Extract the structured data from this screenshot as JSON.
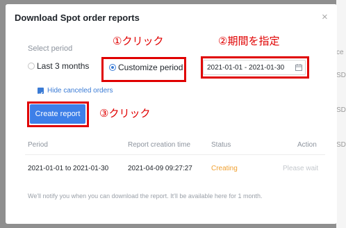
{
  "background": {
    "column_texts": [
      "ce",
      "SD",
      "SD",
      "SD"
    ]
  },
  "dialog": {
    "title": "Download Spot order reports",
    "close_symbol": "×",
    "select_period_label": "Select period",
    "options": {
      "last3": "Last 3 months",
      "customize": "Customize period"
    },
    "selected_option": "Customize period",
    "date_range": "2021-01-01 - 2021-01-30",
    "hide_canceled_label": "Hide canceled orders",
    "hide_canceled_checked": true,
    "create_button": "Create report",
    "table": {
      "headers": {
        "period": "Period",
        "created": "Report creation time",
        "status": "Status",
        "action": "Action"
      },
      "rows": [
        {
          "period": "2021-01-01 to 2021-01-30",
          "created": "2021-04-09 09:27:27",
          "status": "Creating",
          "action": "Please wait"
        }
      ]
    },
    "footer_note": "We'll notify you when you can download the report. It'll be available here for 1 month."
  },
  "annotations": {
    "step1": "①クリック",
    "step2": "②期間を指定",
    "step3": "③クリック"
  },
  "colors": {
    "accent": "#3d7fe8",
    "annotation_red": "#e00000",
    "status_creating": "#f0a030"
  },
  "icons": [
    "close-icon",
    "calendar-icon",
    "checkbox-checked-icon"
  ]
}
